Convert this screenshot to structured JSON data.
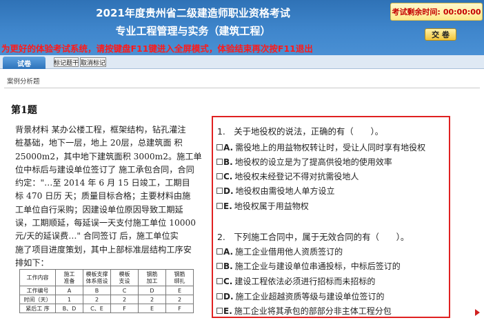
{
  "header": {
    "title": "2021年度贵州省二级建造师职业资格考试",
    "subtitle": "专业工程管理与实务（建筑工程）",
    "notice": "为更好的体验考试系统，请按键盘F11键进入全屏模式，体验结束再次按F11退出",
    "timer_label": "考试剩余时间:",
    "timer_value": "00:00:00",
    "submit_label": "交 卷"
  },
  "toolbar": {
    "tab_label": "试卷",
    "mark_label": "标记题干",
    "unmark_label": "取消标记"
  },
  "section_label": "案例分析题",
  "question_number": "第1题",
  "material_lines": [
    "背景材料 某办公楼工程，框架结构，钻孔灌注",
    "桩基础，地下一层，地上 20层，总建筑面 积",
    "25000m2，其中地下建筑面积 3000m2。施工单",
    "位中标后与建设单位签订了 施工承包合同，合同",
    "约定：\"…至 2014 年 6 月 15 日竣工，工期目",
    "标 470 日历 天；质量目标合格；主要材料由施",
    "工单位自行采购；因建设单位原因导致工期延",
    "误，工期顺延，每延误一天支付施工单位 10000",
    "元/天的延误费…\" 合同签订 后，施工单位实",
    "施了项目进度策划，其中上部标准层结构工序安",
    "排如下："
  ],
  "table": {
    "header": [
      "工作内容",
      "施工\n准备",
      "模板支撑\n体系搭设",
      "模板\n支设",
      "钢筋\n加工",
      "钢筋\n绑扎"
    ],
    "rows": [
      [
        "工作编号",
        "A",
        "B",
        "C",
        "D",
        "E"
      ],
      [
        "时间（天）",
        "1",
        "2",
        "2",
        "2",
        "2"
      ],
      [
        "紧后工 序",
        "B、D",
        "C、E",
        "F",
        "E",
        "F"
      ]
    ]
  },
  "questions": [
    {
      "stem": "1.　关于地役权的说法，正确的有（　　）。",
      "options": [
        {
          "key": "A.",
          "text": "需役地上的用益物权转让时，受让人同时享有地役权"
        },
        {
          "key": "B.",
          "text": "地役权的设立是为了提高供役地的使用效率"
        },
        {
          "key": "C.",
          "text": "地役权未经登记不得对抗需役地人"
        },
        {
          "key": "D.",
          "text": "地役权由需役地人单方设立"
        },
        {
          "key": "E.",
          "text": "地役权属于用益物权"
        }
      ]
    },
    {
      "stem": "2.　下列施工合同中，属于无效合同的有（　　）。",
      "options": [
        {
          "key": "A.",
          "text": "施工企业借用他人资质签订的"
        },
        {
          "key": "B.",
          "text": "施工企业与建设单位串通投标，中标后签订的"
        },
        {
          "key": "C.",
          "text": "建设工程依法必须进行招标而未招标的"
        },
        {
          "key": "D.",
          "text": "施工企业超越资质等级与建设单位签订的"
        },
        {
          "key": "E.",
          "text": "施工企业将其承包的部部分非主体工程分包"
        }
      ]
    }
  ],
  "colors": {
    "header_blue": "#3f86cc",
    "notice_red": "#ff1a1a",
    "panel_border": "#e02020",
    "timer_bg": "#ffe98a"
  }
}
